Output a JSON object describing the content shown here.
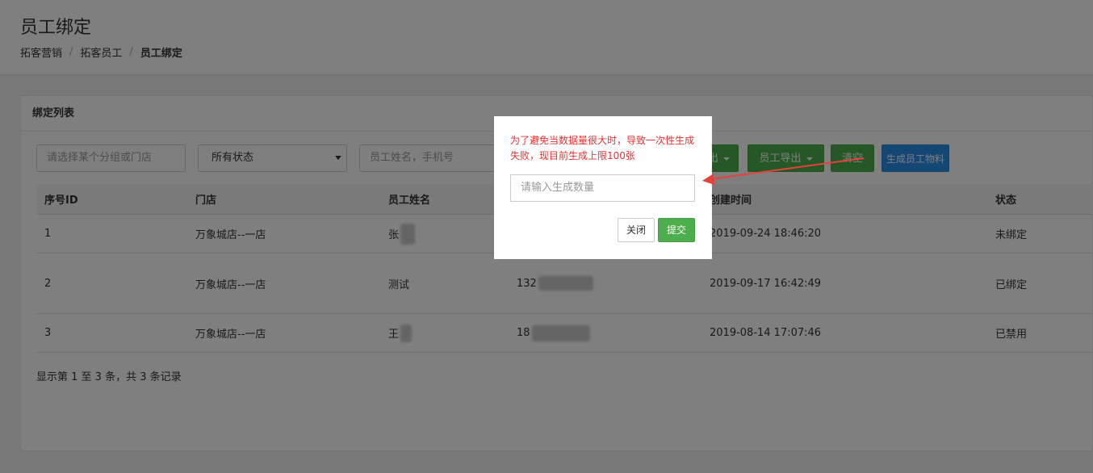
{
  "header": {
    "title": "员工绑定",
    "breadcrumb": [
      "拓客营销",
      "拓客员工",
      "员工绑定"
    ],
    "separator": "/"
  },
  "panel": {
    "title": "绑定列表"
  },
  "filters": {
    "group_placeholder": "请选择某个分组或门店",
    "status_selected": "所有状态",
    "search_placeholder": "员工姓名，手机号",
    "export_label": "出",
    "employee_export_label": "员工导出",
    "clear_label": "清空",
    "generate_label": "生成员工物料"
  },
  "table": {
    "columns": [
      "序号ID",
      "门店",
      "员工姓名",
      "",
      "创建时间",
      "状态"
    ],
    "rows": [
      {
        "id": "1",
        "store": "万象城店--一店",
        "name": "张",
        "phone": "",
        "created": "2019-09-24 18:46:20",
        "status": "未绑定"
      },
      {
        "id": "2",
        "store": "万象城店--一店",
        "name": "测试",
        "phone": "132",
        "created": "2019-09-17 16:42:49",
        "status": "已绑定"
      },
      {
        "id": "3",
        "store": "万象城店--一店",
        "name": "王",
        "phone": "18",
        "created": "2019-08-14 17:07:46",
        "status": "已禁用"
      }
    ]
  },
  "summary": "显示第 1 至 3 条，共 3 条记录",
  "modal": {
    "message": "为了避免当数据量很大时，导致一次性生成失败，现目前生成上限100张",
    "input_placeholder": "请输入生成数量",
    "close_label": "关闭",
    "submit_label": "提交"
  },
  "colors": {
    "green": "#4cae4c",
    "blue": "#2b8fe8",
    "warning_red": "#e53333",
    "annotation_arrow": "#e8403a"
  }
}
